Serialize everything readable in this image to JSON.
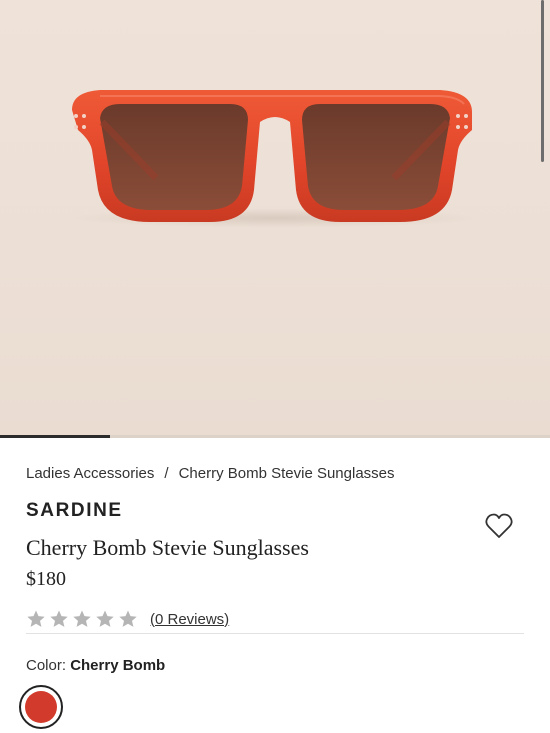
{
  "breadcrumb": {
    "items": [
      "Ladies Accessories",
      "Cherry Bomb Stevie Sunglasses"
    ],
    "separator": "/"
  },
  "product": {
    "brand": "SARDINE",
    "title": "Cherry Bomb Stevie Sunglasses",
    "price": "$180",
    "rating": {
      "stars_filled": 0,
      "stars_total": 5,
      "reviews_label": "(0 Reviews)"
    },
    "color": {
      "label": "Color:",
      "value": "Cherry Bomb",
      "swatch_hex": "#d23b2b"
    }
  },
  "gallery": {
    "progress_fraction": 0.2,
    "image_alt_icon": "sunglasses-product-image"
  },
  "icons": {
    "wishlist": "heart-icon",
    "rating": "star-icon"
  },
  "colors": {
    "frame": "#e2452a",
    "lens": "#7a4432",
    "star_empty": "#b5b5b5",
    "background_hero": "#efe3d9"
  }
}
